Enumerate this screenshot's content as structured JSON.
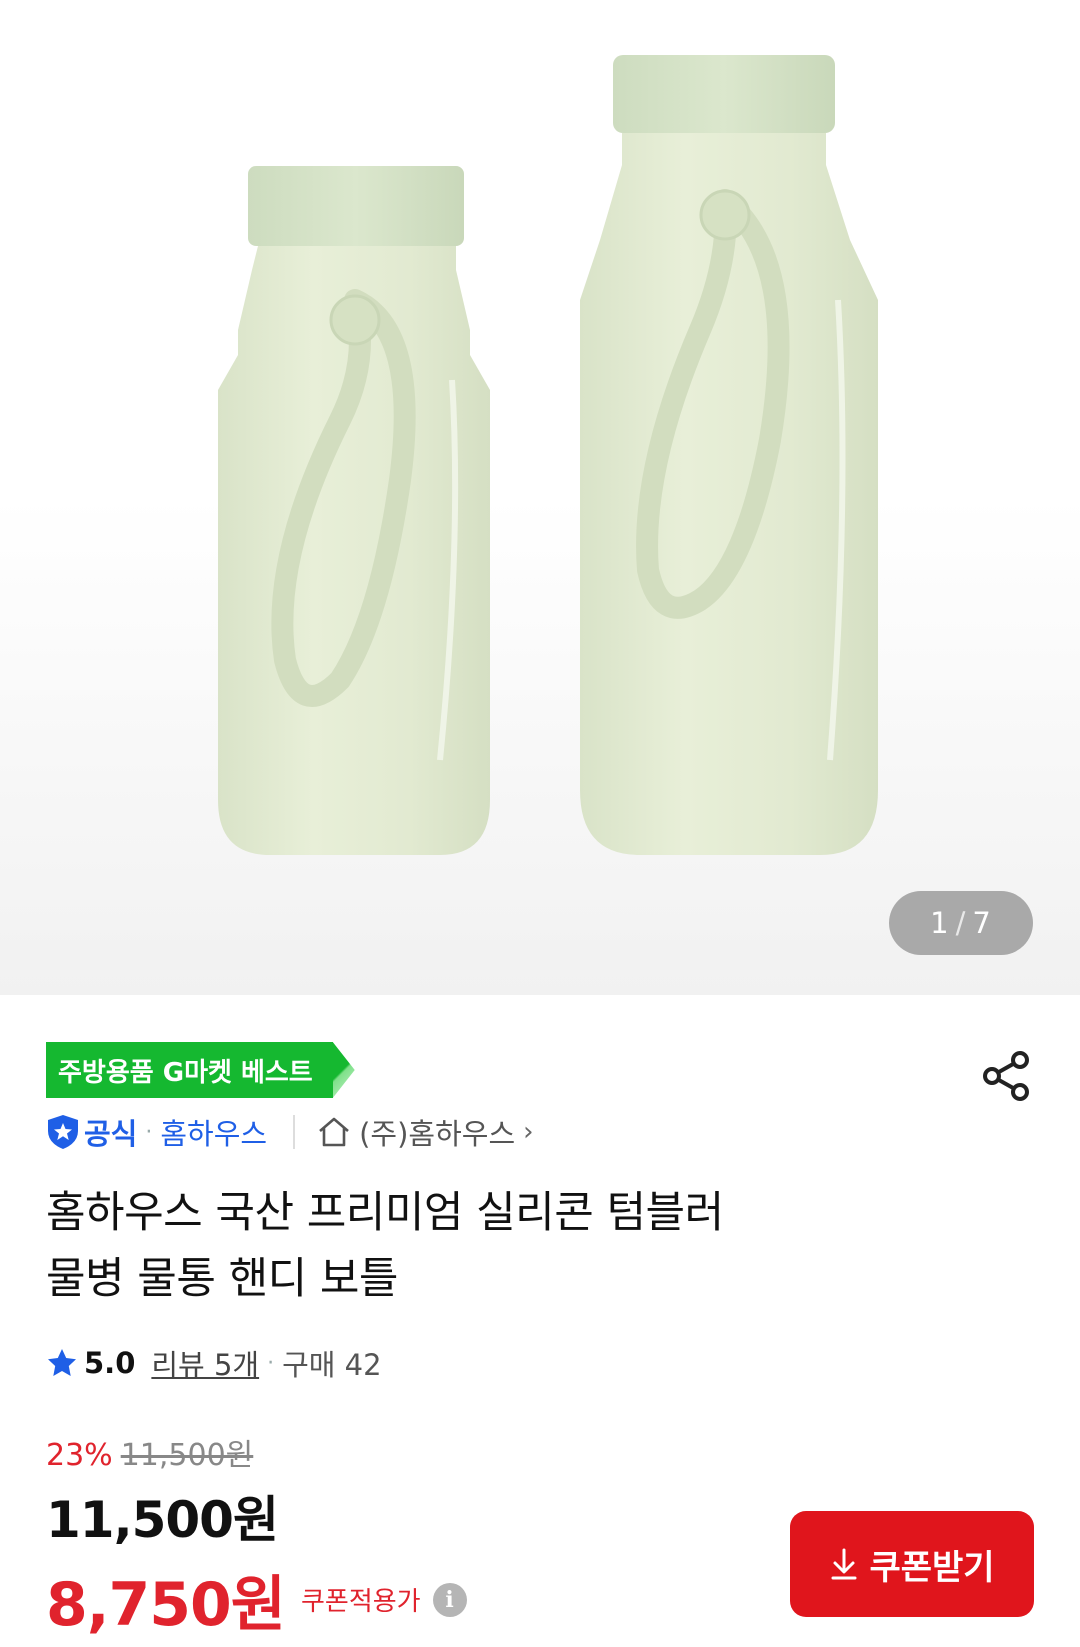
{
  "gallery": {
    "current": "1",
    "separator": "/",
    "total": "7",
    "image_icon": "silicone-bottle-pair-image"
  },
  "badge": {
    "label": "주방용품 G마켓 베스트",
    "color": "#15b830"
  },
  "share": {
    "icon": "share-icon"
  },
  "seller": {
    "official_label": "공식",
    "name": "홈하우스",
    "shop_label": "(주)홈하우스",
    "chevron": "›"
  },
  "product": {
    "title_line1": "홈하우스 국산 프리미엄 실리콘 텀블러",
    "title_line2": "물병 물통 핸디 보틀"
  },
  "rating": {
    "score": "5.0",
    "reviews": "리뷰 5개",
    "dot": "·",
    "purchases": "구매 42"
  },
  "pricing": {
    "discount_rate": "23%",
    "original_price": "11,500원",
    "price": "11,500원",
    "coupon_price": "8,750원",
    "coupon_label": "쿠폰적용가",
    "info_icon": "i",
    "accent_color": "#e0232d"
  },
  "coupon_button": {
    "label": "쿠폰받기",
    "icon": "download-arrow-icon"
  }
}
